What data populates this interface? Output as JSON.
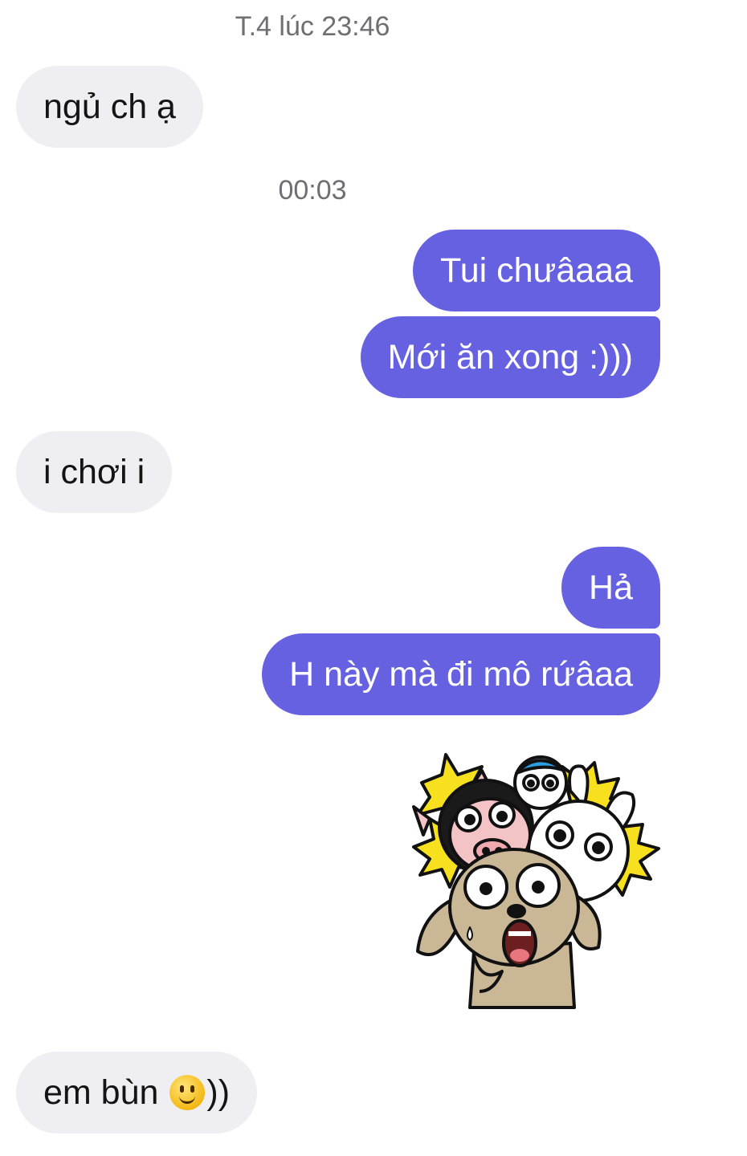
{
  "conversation": {
    "timestamps": [
      "T.4 lúc 23:46",
      "00:03"
    ],
    "messages": [
      {
        "direction": "incoming",
        "text": "ngủ ch ạ"
      },
      {
        "direction": "outgoing",
        "text": "Tui chưâaaa"
      },
      {
        "direction": "outgoing",
        "text": "Mới ăn xong :)))"
      },
      {
        "direction": "incoming",
        "text": "i chơi i"
      },
      {
        "direction": "outgoing",
        "text": "Hả"
      },
      {
        "direction": "outgoing",
        "text": "H này mà đi mô rứâaa"
      },
      {
        "direction": "outgoing",
        "type": "sticker",
        "sticker": "shocked-animals-sticker"
      },
      {
        "direction": "incoming",
        "text": "em bùn",
        "suffix": "))",
        "emoji": "slightly-smiling-face-icon"
      }
    ]
  },
  "colors": {
    "outgoing_bubble": "#6561e0",
    "incoming_bubble": "#efeff3",
    "timestamp_text": "#6e6e73"
  }
}
